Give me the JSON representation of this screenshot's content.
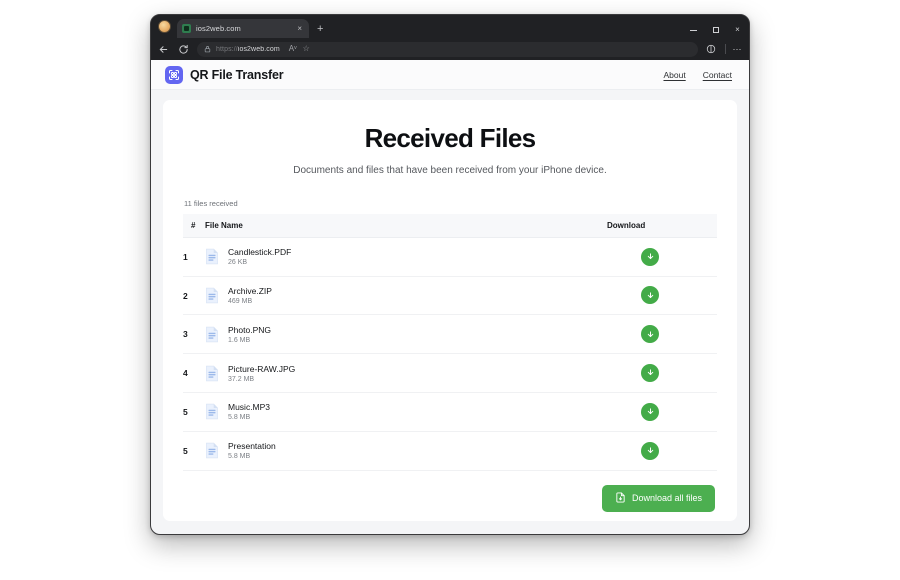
{
  "browser": {
    "tab": {
      "title": "ios2web.com",
      "favicon": "site-favicon",
      "close": "×"
    },
    "new_tab": "+",
    "window_controls": {
      "minimize": "minimize-icon",
      "maximize": "maximize-icon",
      "close": "×"
    },
    "toolbar": {
      "back": "back-arrow-icon",
      "reload": "reload-icon",
      "lock": "lock-icon",
      "url_scheme": "https://",
      "url_host": "ios2web.com",
      "read_aloud": "Aᵛ",
      "favorite": "☆",
      "split_screen": "split-screen-icon",
      "more": "⋯"
    }
  },
  "site": {
    "brand": {
      "logo": "qr-scan-icon",
      "name": "QR File Transfer"
    },
    "nav": [
      {
        "label": "About",
        "name": "about"
      },
      {
        "label": "Contact",
        "name": "contact"
      }
    ]
  },
  "main": {
    "title": "Received Files",
    "subtitle": "Documents and files that have been received from your iPhone device.",
    "file_count_label": "11 files received",
    "columns": {
      "number": "#",
      "file_name": "File Name",
      "download": "Download"
    },
    "files": [
      {
        "num": "1",
        "name": "Candlestick.PDF",
        "size": "26 KB"
      },
      {
        "num": "2",
        "name": "Archive.ZIP",
        "size": "469 MB"
      },
      {
        "num": "3",
        "name": "Photo.PNG",
        "size": "1.6 MB"
      },
      {
        "num": "4",
        "name": "Picture-RAW.JPG",
        "size": "37.2 MB"
      },
      {
        "num": "5",
        "name": "Music.MP3",
        "size": "5.8 MB"
      },
      {
        "num": "5",
        "name": "Presentation",
        "size": "5.8 MB"
      }
    ],
    "download_all_label": "Download all files"
  },
  "colors": {
    "brand_indigo": "#6366f1",
    "download_green": "#4caf50",
    "row_button_green": "#43ab48",
    "page_bg": "#f4f5f7",
    "card_bg": "#ffffff"
  }
}
